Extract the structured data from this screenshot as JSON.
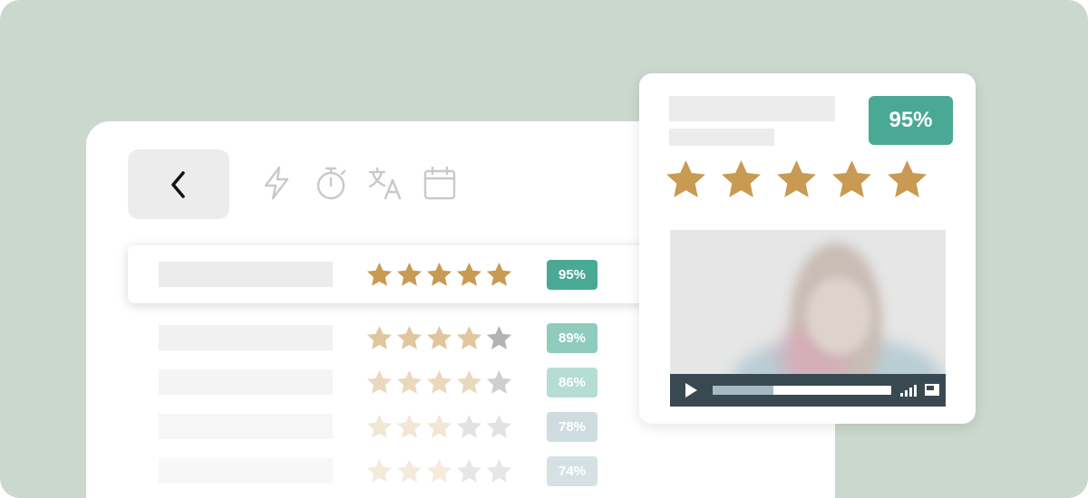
{
  "panel": {
    "toolbar_icons": [
      "lightning-icon",
      "stopwatch-icon",
      "translate-icon",
      "calendar-icon"
    ],
    "rows": [
      {
        "rating": 5,
        "score": "95%",
        "badge_color": "#4aa994",
        "star_color": "#c89a52",
        "empty_star_color": "#b3b3b3",
        "opacity": 1
      },
      {
        "rating": 4,
        "score": "89%",
        "badge_color": "#8fccbe",
        "star_color": "#e1c69d",
        "empty_star_color": "#b3b3b3",
        "opacity": 1
      },
      {
        "rating": 4,
        "score": "86%",
        "badge_color": "#b6ddd3",
        "star_color": "#ead9bd",
        "empty_star_color": "#cfcfcf",
        "opacity": 1
      },
      {
        "rating": 3,
        "score": "78%",
        "badge_color": "#cfdcdf",
        "star_color": "#f2e6d4",
        "empty_star_color": "#e2e2e2",
        "opacity": 1
      },
      {
        "rating": 3,
        "score": "74%",
        "badge_color": "#d6e1e3",
        "star_color": "#f4ebdd",
        "empty_star_color": "#e6e6e6",
        "opacity": 1
      }
    ]
  },
  "card": {
    "score": "95%",
    "rating": 5,
    "star_color": "#c89a52",
    "video": {
      "progress": 0.34
    }
  },
  "colors": {
    "background": "#cbd8cd",
    "accent": "#4aa994",
    "star_gold": "#c89a52",
    "video_controls": "#394952"
  }
}
